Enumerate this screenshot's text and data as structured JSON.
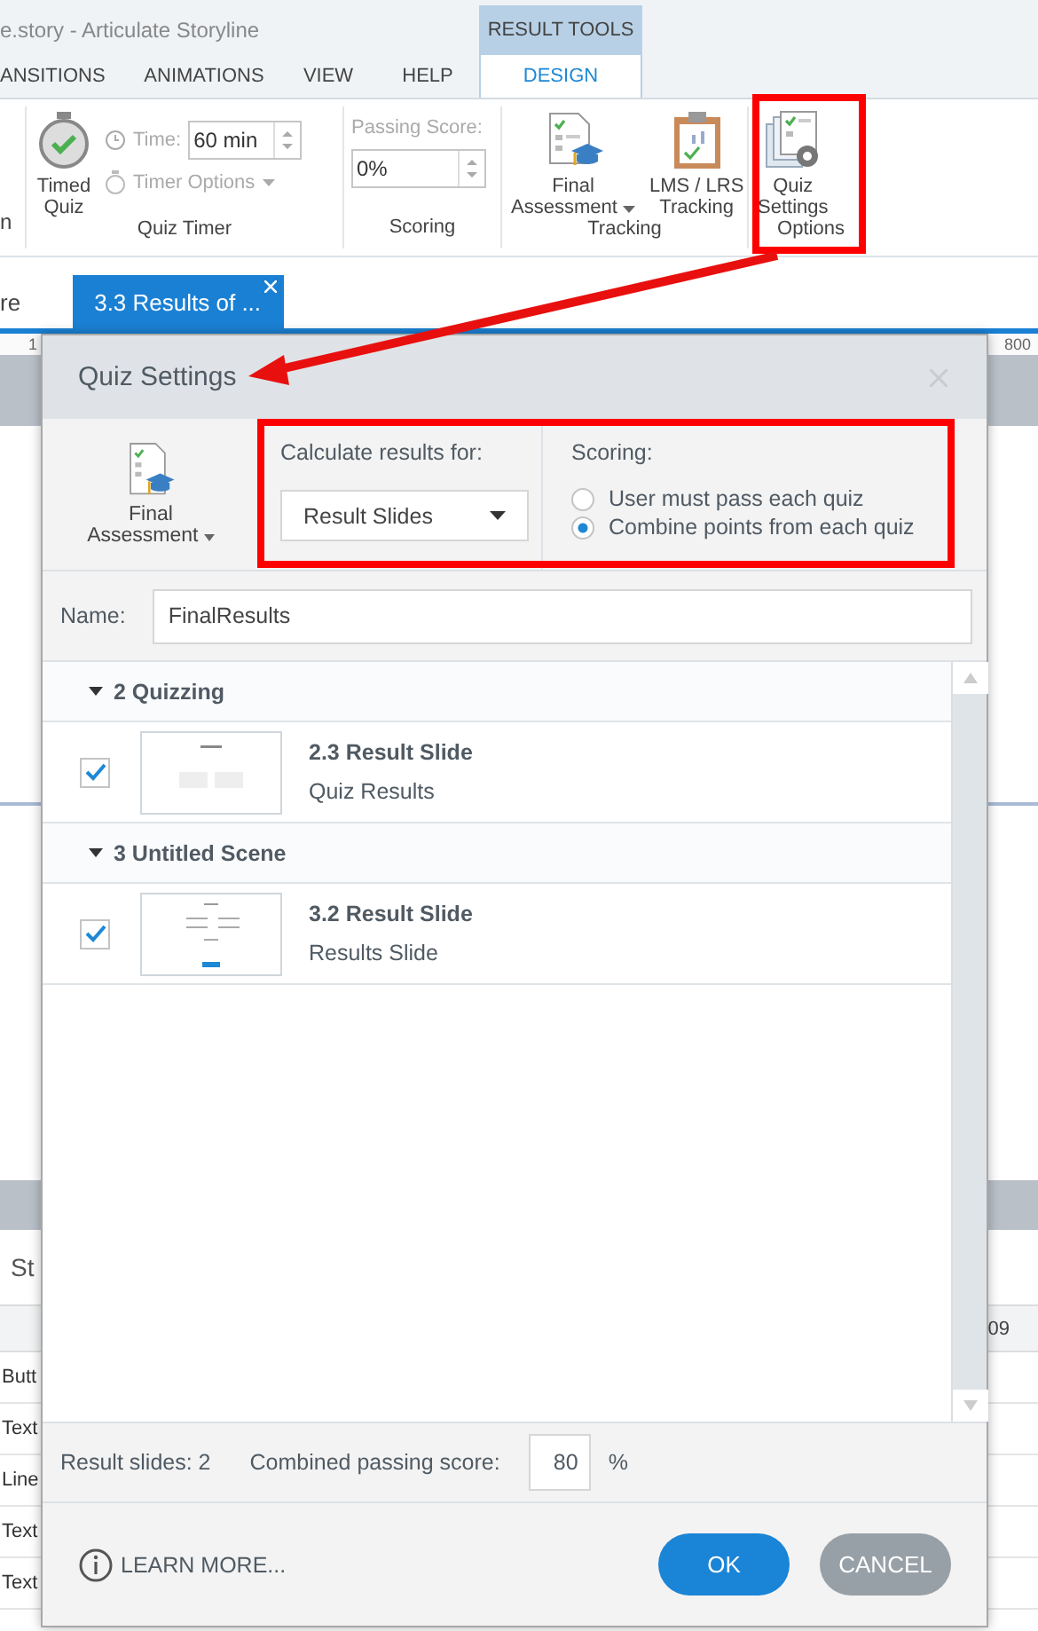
{
  "window": {
    "title": "e.story -  Articulate Storyline"
  },
  "context_tab": {
    "label": "RESULT TOOLS"
  },
  "ribbon_tabs": [
    {
      "label": "ANSITIONS",
      "selected": false
    },
    {
      "label": "ANIMATIONS",
      "selected": false
    },
    {
      "label": "VIEW",
      "selected": false
    },
    {
      "label": "HELP",
      "selected": false
    },
    {
      "label": "DESIGN",
      "selected": true
    }
  ],
  "ribbon": {
    "cut_button": {
      "label": "n"
    },
    "quiz_timer": {
      "timed_quiz": "Timed\nQuiz",
      "time": {
        "label": "Time:",
        "value": "60 min",
        "disabled": true
      },
      "timer_options": {
        "label": "Timer Options",
        "disabled": true
      },
      "group_label": "Quiz Timer"
    },
    "scoring": {
      "passing_score": {
        "label": "Passing Score:",
        "value": "0%",
        "disabled": true
      },
      "group_label": "Scoring"
    },
    "tracking": {
      "final_assessment": "Final\nAssessment",
      "lms_tracking": "LMS / LRS\nTracking",
      "group_label": "Tracking"
    },
    "options": {
      "quiz_settings": "Quiz\nSettings",
      "group_label": "Options"
    }
  },
  "document_tabs": [
    {
      "label": "re",
      "selected": false
    },
    {
      "label": "3.3 Results of ...",
      "selected": true
    }
  ],
  "ruler": {
    "start": "1",
    "end": "800"
  },
  "story_panel": {
    "title": "St",
    "timeline_tick": "09",
    "rows": [
      "Butt",
      "Text",
      "Line",
      "Text",
      "Text"
    ]
  },
  "dialog": {
    "title": "Quiz Settings",
    "assessment": "Final\nAssessment",
    "calculate_label": "Calculate results for:",
    "calculate_value": "Result Slides",
    "scoring_label": "Scoring:",
    "scoring_options": [
      {
        "label": "User must pass each quiz",
        "selected": false
      },
      {
        "label": "Combine points from each quiz",
        "selected": true
      }
    ],
    "name_label": "Name:",
    "name_value": "FinalResults",
    "scenes": [
      {
        "title": "2 Quizzing",
        "expanded": true,
        "children": [
          {
            "title": "2.3 Result Slide",
            "subtitle": "Quiz Results",
            "checked": true
          }
        ]
      },
      {
        "title": "3 Untitled Scene",
        "expanded": true,
        "children": [
          {
            "title": "3.2 Result Slide",
            "subtitle": "Results Slide",
            "checked": true
          }
        ]
      }
    ],
    "result_count": "Result slides: 2",
    "passing_label": "Combined passing score:",
    "passing_value": "80",
    "passing_unit": "%",
    "learn_more": "LEARN MORE...",
    "buttons": [
      {
        "label": "OK",
        "kind": "primary"
      },
      {
        "label": "CANCEL",
        "kind": "secondary"
      }
    ]
  }
}
